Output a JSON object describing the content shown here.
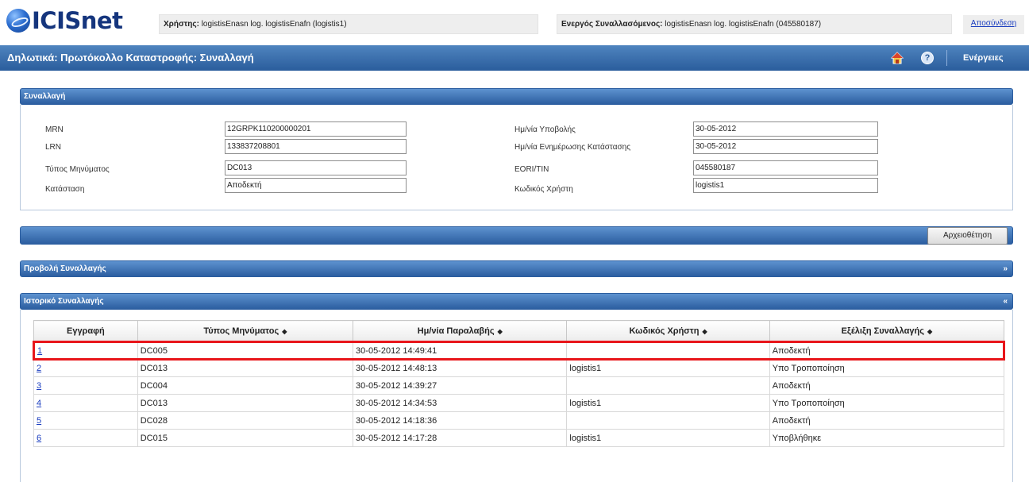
{
  "brand": {
    "logo_text": "ICISnet",
    "logo_icon": "globe-icon"
  },
  "user_bar": {
    "user_label": "Χρήστης:",
    "user_value": "logistisEnasn log. logistisEnafn (logistis1)",
    "active_label": "Ενεργός Συναλλασόμενος:",
    "active_value": "logistisEnasn log. logistisEnafn (045580187)",
    "logout_label": "Αποσύνδεση"
  },
  "header": {
    "title": "Δηλωτικά: Πρωτόκολλο Καταστροφής: Συναλλαγή",
    "home_icon": "home-icon",
    "help_icon": "help-icon",
    "help_symbol": "?",
    "actions_label": "Ενέργειες"
  },
  "transaction": {
    "panel_title": "Συναλλαγή",
    "left_fields": [
      {
        "label": "MRN",
        "value": "12GRPK110200000201"
      },
      {
        "label": "LRN",
        "value": "133837208801"
      },
      {
        "label": "Τύπος Μηνύματος",
        "value": "DC013"
      },
      {
        "label": "Κατάσταση",
        "value": "Αποδεκτή"
      }
    ],
    "right_fields": [
      {
        "label": "Ημ/νία Υποβολής",
        "value": "30-05-2012"
      },
      {
        "label": "Ημ/νία Ενημέρωσης Κατάστασης",
        "value": "30-05-2012"
      },
      {
        "label": "EORI/TIN",
        "value": "045580187"
      },
      {
        "label": "Κωδικός Χρήστη",
        "value": "logistis1"
      }
    ]
  },
  "archive_button": "Αρχειοθέτηση",
  "view_panel": {
    "title": "Προβολή Συναλλαγής",
    "toggle": "»"
  },
  "history": {
    "title": "Ιστορικό Συναλλαγής",
    "toggle": "«",
    "sort_glyph": "◆",
    "columns": [
      "Εγγραφή",
      "Τύπος Μηνύματος",
      "Ημ/νία Παραλαβής",
      "Κωδικός Χρήστη",
      "Εξέλιξη Συναλλαγής"
    ],
    "rows": [
      {
        "id": "1",
        "type": "DC005",
        "date": "30-05-2012 14:49:41",
        "user": "",
        "status": "Αποδεκτή"
      },
      {
        "id": "2",
        "type": "DC013",
        "date": "30-05-2012 14:48:13",
        "user": "logistis1",
        "status": "Υπο Τροποποίηση"
      },
      {
        "id": "3",
        "type": "DC004",
        "date": "30-05-2012 14:39:27",
        "user": "",
        "status": "Αποδεκτή"
      },
      {
        "id": "4",
        "type": "DC013",
        "date": "30-05-2012 14:34:53",
        "user": "logistis1",
        "status": "Υπο Τροποποίηση"
      },
      {
        "id": "5",
        "type": "DC028",
        "date": "30-05-2012 14:18:36",
        "user": "",
        "status": "Αποδεκτή"
      },
      {
        "id": "6",
        "type": "DC015",
        "date": "30-05-2012 14:17:28",
        "user": "logistis1",
        "status": "Υποβλήθηκε"
      }
    ]
  },
  "colors": {
    "header_blue": "#2a5d9c",
    "link_blue": "#1a3dbf",
    "highlight_red": "#e8161b",
    "logo_navy": "#15357d"
  }
}
